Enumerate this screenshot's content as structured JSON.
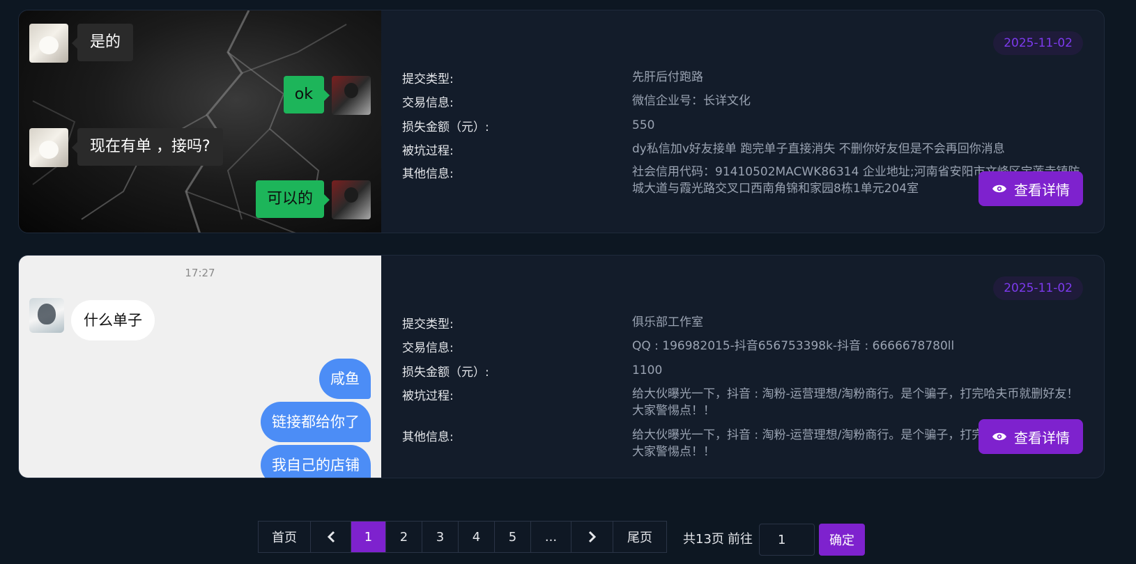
{
  "cards": [
    {
      "date": "2025-11-02",
      "chat": [
        {
          "text": "是的"
        },
        {
          "text": "ok"
        },
        {
          "text": "现在有单 ，接吗?"
        },
        {
          "text": "可以的"
        }
      ],
      "labels": [
        "提交类型:",
        "交易信息:",
        "损失金额（元）:",
        "被坑过程:",
        "其他信息:"
      ],
      "values": [
        "先肝后付跑路",
        "微信企业号：长详文化",
        "550",
        "dy私信加v好友接单 跑完单子直接消失 不删你好友但是不会再回你消息",
        "社会信用代码：91410502MACWK86314 企业地址;河南省安阳市文峰区宝莲寺镇防城大道与霞光路交叉口西南角锦和家园8栋1单元204室"
      ],
      "button": "查看详情"
    },
    {
      "date": "2025-11-02",
      "time": "17:27",
      "chat": [
        {
          "text": "什么单子"
        },
        {
          "text": "咸鱼"
        },
        {
          "text": "链接都给你了"
        },
        {
          "text": "我自己的店铺"
        }
      ],
      "labels": [
        "提交类型:",
        "交易信息:",
        "损失金额（元）:",
        "被坑过程:",
        "其他信息:"
      ],
      "values": [
        "俱乐部工作室",
        "QQ : 196982015-抖音656753398k-抖音 : 6666678780ll",
        "1100",
        "给大伙曝光一下，抖音 : 淘粉-运营理想/淘粉商行。是个骗子，打完哈夫币就删好友！大家警惕点！！",
        "给大伙曝光一下，抖音 : 淘粉-运营理想/淘粉商行。是个骗子，打完哈夫币就删好友！大家警惕点！！"
      ],
      "button": "查看详情"
    }
  ],
  "pagination": {
    "first": "首页",
    "pages": [
      "1",
      "2",
      "3",
      "4",
      "5",
      "..."
    ],
    "current": "1",
    "last": "尾页",
    "total": "共13页",
    "goto": "前往",
    "input_value": "1",
    "confirm": "确定"
  },
  "colors": {
    "accent": "#7e22ce",
    "date_text": "#7c3aed",
    "background": "#0d1722",
    "card": "#131c2a"
  },
  "icons": {
    "detail": "eye-icon",
    "prev": "chevron-left-icon",
    "next": "chevron-right-icon"
  }
}
